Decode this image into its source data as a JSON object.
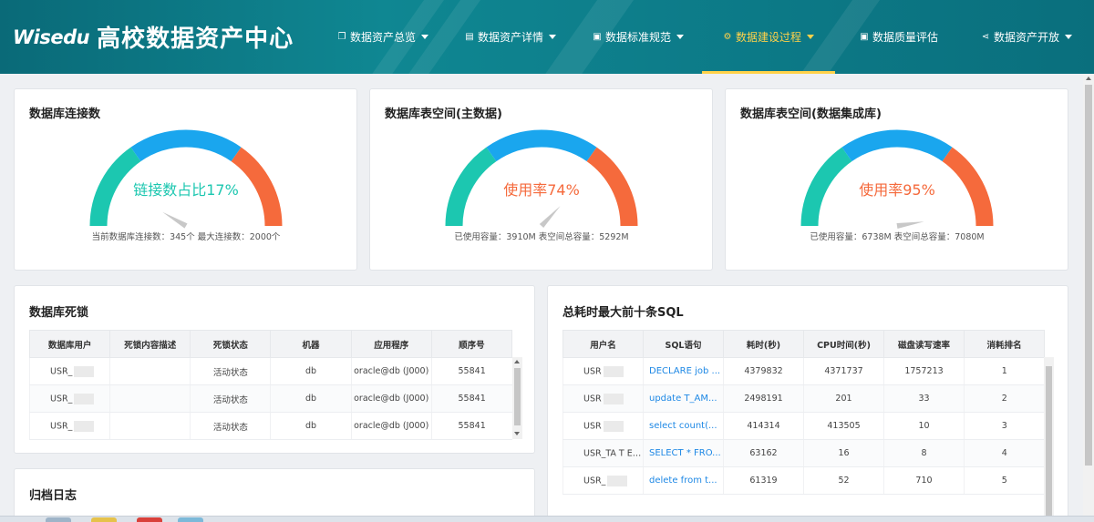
{
  "header": {
    "logo_word": "Wisedu",
    "title": "高校数据资产中心",
    "nav": [
      {
        "label": "数据资产总览",
        "icon": "copy-icon",
        "glyph": "❐",
        "caret": true,
        "active": false
      },
      {
        "label": "数据资产详情",
        "icon": "document-icon",
        "glyph": "▤",
        "caret": true,
        "active": false
      },
      {
        "label": "数据标准规范",
        "icon": "clipboard-icon",
        "glyph": "▣",
        "caret": true,
        "active": false
      },
      {
        "label": "数据建设过程",
        "icon": "gear-icon",
        "glyph": "⚙",
        "caret": true,
        "active": true
      },
      {
        "label": "数据质量评估",
        "icon": "clipboard-check-icon",
        "glyph": "▣",
        "caret": false,
        "active": false
      },
      {
        "label": "数据资产开放",
        "icon": "share-icon",
        "glyph": "⋖",
        "caret": true,
        "active": false
      }
    ]
  },
  "colors": {
    "gauge_green": "#1cc7b0",
    "gauge_blue": "#1aa6ee",
    "gauge_orange": "#f56a3c",
    "link": "#1e88e5",
    "active_nav": "#ffd24a"
  },
  "gauges": [
    {
      "title": "数据库连接数",
      "center_text": "链接数占比17%",
      "center_color": "#1cc7b0",
      "percent": 17,
      "caption": "当前数据库连接数：345个  最大连接数：2000个"
    },
    {
      "title": "数据库表空间(主数据)",
      "center_text": "使用率74%",
      "center_color": "#f56a3c",
      "percent": 74,
      "caption": "已使用容量：3910M  表空间总容量：5292M"
    },
    {
      "title": "数据库表空间(数据集成库)",
      "center_text": "使用率95%",
      "center_color": "#f56a3c",
      "percent": 95,
      "caption": "已使用容量：6738M  表空间总容量：7080M"
    }
  ],
  "deadlock": {
    "title": "数据库死锁",
    "headers": [
      "数据库用户",
      "死锁内容描述",
      "死锁状态",
      "机器",
      "应用程序",
      "顺序号"
    ],
    "rows": [
      [
        "USR_",
        "",
        "活动状态",
        "db",
        "oracle@db (J000)",
        "55841"
      ],
      [
        "USR_",
        "",
        "活动状态",
        "db",
        "oracle@db (J000)",
        "55841"
      ],
      [
        "USR_",
        "",
        "活动状态",
        "db",
        "oracle@db (J000)",
        "55841"
      ]
    ]
  },
  "archive": {
    "title": "归档日志"
  },
  "topsql": {
    "title": "总耗时最大前十条SQL",
    "headers": [
      "用户名",
      "SQL语句",
      "耗时(秒)",
      "CPU时间(秒)",
      "磁盘读写速率",
      "消耗排名"
    ],
    "rows": [
      [
        "USR",
        "DECLARE job ...",
        "4379832",
        "4371737",
        "1757213",
        "1"
      ],
      [
        "USR",
        "update T_AM...",
        "2498191",
        "201",
        "33",
        "2"
      ],
      [
        "USR",
        "select count(...",
        "414314",
        "413505",
        "10",
        "3"
      ],
      [
        "USR_TA T E",
        "SELECT * FRO...",
        "63162",
        "16",
        "8",
        "4"
      ],
      [
        "USR_",
        "delete from t...",
        "61319",
        "52",
        "710",
        "5"
      ]
    ]
  }
}
